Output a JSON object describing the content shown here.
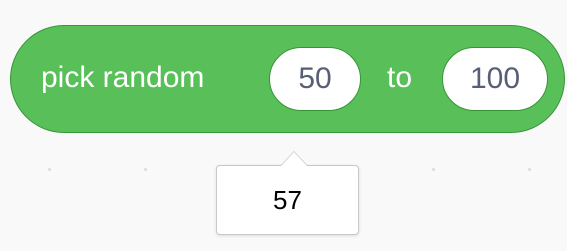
{
  "block": {
    "label": "pick random",
    "from_value": "50",
    "to_label": "to",
    "to_value": "100"
  },
  "result": {
    "value": "57"
  }
}
